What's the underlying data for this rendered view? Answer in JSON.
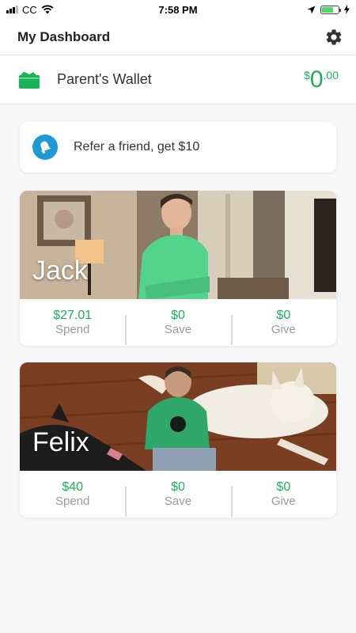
{
  "status_bar": {
    "carrier": "CC",
    "time": "7:58 PM"
  },
  "header": {
    "title": "My Dashboard"
  },
  "wallet": {
    "label": "Parent's Wallet",
    "amount_currency": "$",
    "amount_whole": "0",
    "amount_cents": ".00"
  },
  "refer": {
    "label": "Refer a friend, get $10"
  },
  "kids": [
    {
      "name": "Jack",
      "stats": [
        {
          "value": "$27.01",
          "label": "Spend"
        },
        {
          "value": "$0",
          "label": "Save"
        },
        {
          "value": "$0",
          "label": "Give"
        }
      ]
    },
    {
      "name": "Felix",
      "stats": [
        {
          "value": "$40",
          "label": "Spend"
        },
        {
          "value": "$0",
          "label": "Save"
        },
        {
          "value": "$0",
          "label": "Give"
        }
      ]
    }
  ],
  "colors": {
    "accent_green": "#19b35a",
    "bell_blue": "#1e9bd7",
    "battery_green": "#4cd964"
  },
  "icons": [
    "signal-icon",
    "wifi-icon",
    "location-icon",
    "battery-icon",
    "charging-icon",
    "gear-icon",
    "wallet-icon",
    "bell-icon"
  ]
}
